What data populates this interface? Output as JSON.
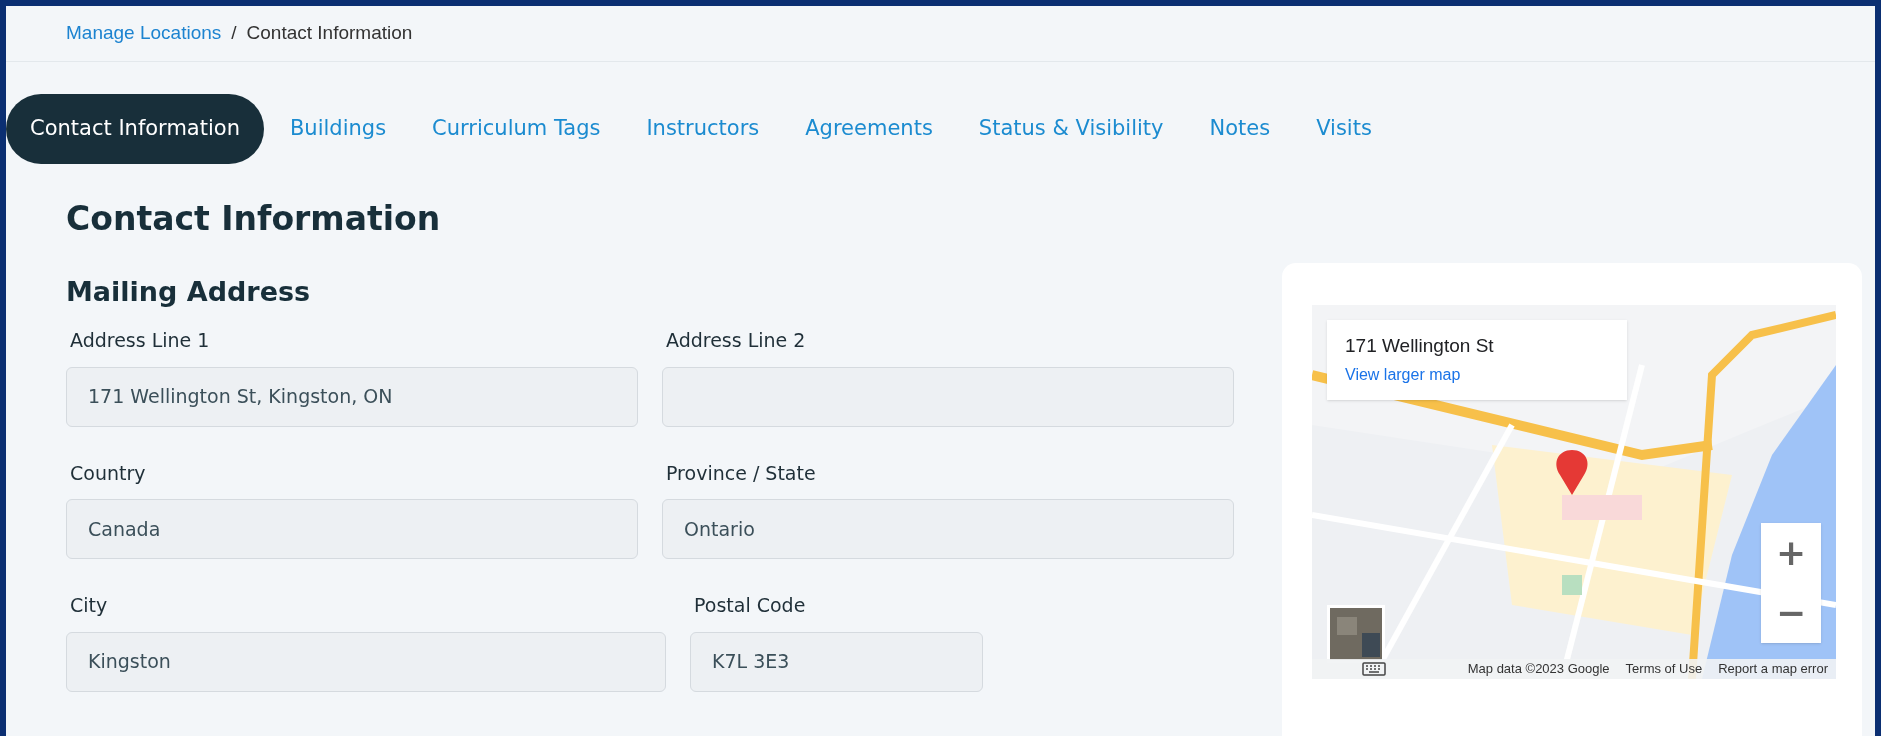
{
  "breadcrumb": [
    {
      "label": "Manage Locations",
      "kind": "link"
    },
    {
      "label": "/",
      "kind": "separator"
    },
    {
      "label": "Contact Information",
      "kind": "current"
    }
  ],
  "tabs": [
    {
      "label": "Contact Information",
      "selected": true
    },
    {
      "label": "Buildings",
      "selected": false
    },
    {
      "label": "Curriculum Tags",
      "selected": false
    },
    {
      "label": "Instructors",
      "selected": false
    },
    {
      "label": "Agreements",
      "selected": false
    },
    {
      "label": "Status & Visibility",
      "selected": false
    },
    {
      "label": "Notes",
      "selected": false
    },
    {
      "label": "Visits",
      "selected": false
    }
  ],
  "page_title": "Contact Information",
  "section_title": "Mailing Address",
  "field_rows": [
    [
      {
        "label": "Address Line 1",
        "value": "171 Wellington St, Kingston, ON",
        "kind": "half"
      },
      {
        "label": "Address Line 2",
        "kind": "half"
      }
    ],
    [
      {
        "label": "Country",
        "value": "Canada",
        "kind": "half"
      },
      {
        "label": "Province / State",
        "value": "Ontario",
        "kind": "half"
      }
    ],
    [
      {
        "label": "City",
        "value": "Kingston",
        "kind": "wide"
      },
      {
        "label": "Postal Code",
        "value": "K7L 3E3",
        "kind": "narrow"
      }
    ]
  ],
  "map": {
    "kind": "picture",
    "info_title": "171 Wellington St",
    "info_link": "View larger map",
    "zoom_in": "+",
    "zoom_out": "−",
    "attribution": [
      "Map data ©2023 Google",
      "Terms of Use",
      "Report a map error"
    ]
  }
}
